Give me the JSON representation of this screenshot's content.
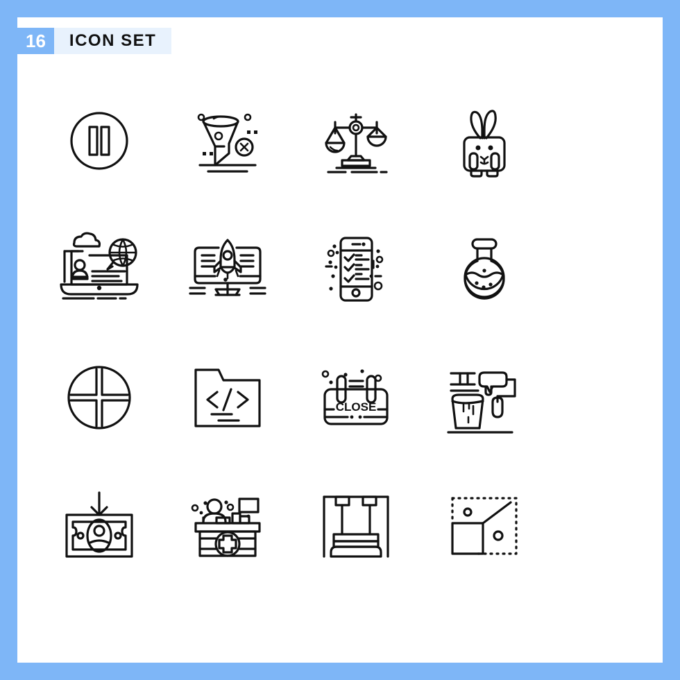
{
  "header": {
    "count": "16",
    "title": "ICON SET",
    "badge_color": "#7eb6f7",
    "strip_color": "#e8f2fd",
    "title_color": "#111111",
    "count_color": "#ffffff"
  },
  "frame": {
    "border_color": "#7eb6f7",
    "canvas_color": "#ffffff",
    "stroke_color": "#111111"
  },
  "grid": {
    "columns": 4,
    "rows": 4,
    "total": 16
  },
  "icons": [
    {
      "index": 1,
      "name": "pause-circle-icon",
      "label": "Pause"
    },
    {
      "index": 2,
      "name": "funnel-remove-icon",
      "label": "Tornado Filter Remove"
    },
    {
      "index": 3,
      "name": "justice-scale-icon",
      "label": "Balance Scale"
    },
    {
      "index": 4,
      "name": "rabbit-icon",
      "label": "Rabbit"
    },
    {
      "index": 5,
      "name": "laptop-cloud-user-icon",
      "label": "Online Learning"
    },
    {
      "index": 6,
      "name": "monitor-rocket-icon",
      "label": "Startup Launch"
    },
    {
      "index": 7,
      "name": "mobile-checklist-icon",
      "label": "Mobile Checklist"
    },
    {
      "index": 8,
      "name": "lab-flask-icon",
      "label": "Laboratory Flask"
    },
    {
      "index": 9,
      "name": "crossed-circle-icon",
      "label": "Quartered Circle"
    },
    {
      "index": 10,
      "name": "code-folder-icon",
      "label": "Code Folder"
    },
    {
      "index": 11,
      "name": "close-sign-icon",
      "label": "Close Sign"
    },
    {
      "index": 12,
      "name": "paint-roller-bucket-icon",
      "label": "Paint Roller"
    },
    {
      "index": 13,
      "name": "money-deposit-icon",
      "label": "Money Deposit"
    },
    {
      "index": 14,
      "name": "pharmacy-counter-icon",
      "label": "Pharmacy Counter"
    },
    {
      "index": 15,
      "name": "chess-rook-icon",
      "label": "Chess Rook"
    },
    {
      "index": 16,
      "name": "scale-resize-icon",
      "label": "Scale Resize"
    }
  ],
  "labels": {
    "close_sign_text": "CLOSE",
    "code_folder_text": "</>"
  }
}
